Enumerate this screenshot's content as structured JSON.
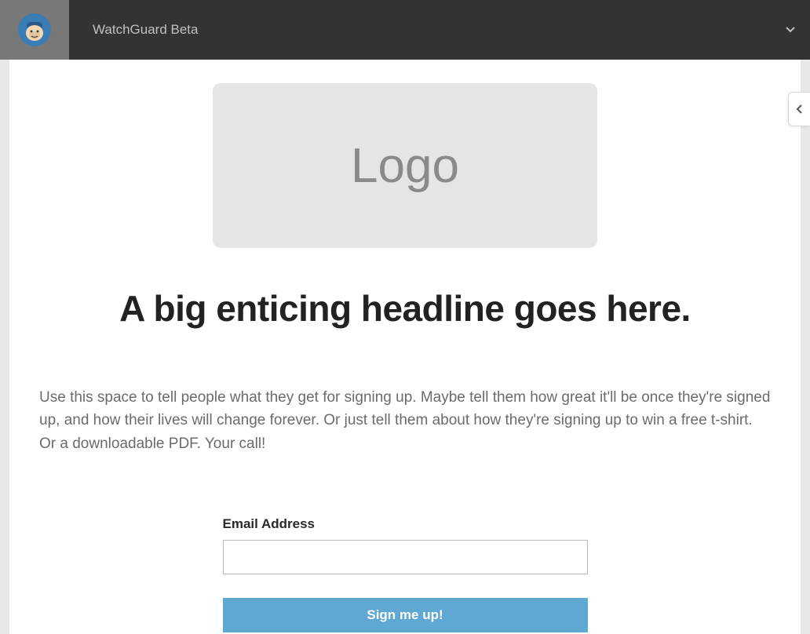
{
  "header": {
    "account_name": "WatchGuard Beta"
  },
  "content": {
    "logo_placeholder_text": "Logo",
    "headline": "A big enticing headline goes here.",
    "description": "Use this space to tell people what they get for signing up. Maybe tell them how great it'll be once they're signed up, and how their lives will change forever. Or just tell them about how they're signing up to win a free t-shirt. Or a downloadable PDF. Your call!",
    "form": {
      "email_label": "Email Address",
      "email_value": "",
      "submit_label": "Sign me up!"
    }
  }
}
